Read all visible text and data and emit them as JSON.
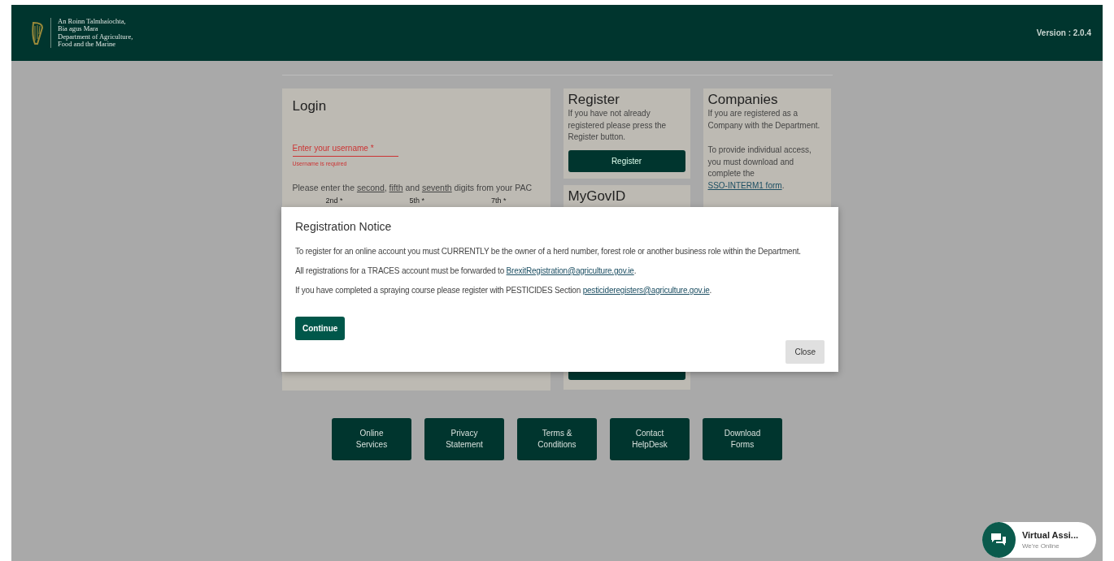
{
  "header": {
    "logo_lines": [
      "An Roinn Talmhaíochta,",
      "Bia agus Mara",
      "Department of Agriculture,",
      "Food and the Marine"
    ],
    "version": "Version : 2.0.4"
  },
  "login": {
    "title": "Login",
    "username": {
      "placeholder": "Enter your username *",
      "error": "Username is required",
      "invalid": true
    },
    "pac_instruction": [
      {
        "text": "Please enter the ",
        "underlined": false
      },
      {
        "text": "second",
        "underlined": true
      },
      {
        "text": ", ",
        "underlined": false
      },
      {
        "text": "fifth",
        "underlined": true
      },
      {
        "text": " and ",
        "underlined": false
      },
      {
        "text": "seventh",
        "underlined": true
      },
      {
        "text": " digits from your PAC",
        "underlined": false
      }
    ],
    "pac_fields": [
      {
        "label": "2nd *"
      },
      {
        "label": "5th *"
      },
      {
        "label": "7th *"
      }
    ]
  },
  "register": {
    "title": "Register",
    "text": "If you have not already registered please press the Register button.",
    "button": "Register"
  },
  "mygovid": {
    "title": "MyGovID"
  },
  "companies": {
    "title": "Companies",
    "text": "If you are registered as a Company with the Department.",
    "access_text": "To provide individual access, you must download and complete the",
    "link": "SSO-INTERM1 form",
    "after_link": "."
  },
  "modal": {
    "title": "Registration Notice",
    "paragraphs": [
      [
        {
          "text": "To register for an online account you must CURRENTLY be the owner of a herd number, forest role or another business role within the Department.",
          "link": false
        }
      ],
      [
        {
          "text": "All registrations for a TRACES account must be forwarded to ",
          "link": false
        },
        {
          "text": "BrexitRegistration@agriculture.gov.ie",
          "link": true
        },
        {
          "text": ".",
          "link": false
        }
      ],
      [
        {
          "text": "If you have completed a spraying course please register with PESTICIDES Section ",
          "link": false
        },
        {
          "text": "pesticideregisters@agriculture.gov.ie",
          "link": true
        },
        {
          "text": ".",
          "link": false
        }
      ]
    ],
    "continue": "Continue",
    "close": "Close"
  },
  "footer_buttons": [
    [
      "Online",
      "Services"
    ],
    [
      "Privacy",
      "Statement"
    ],
    [
      "Terms &",
      "Conditions"
    ],
    [
      "Contact",
      "HelpDesk"
    ],
    [
      "Download",
      "Forms"
    ]
  ],
  "chat": {
    "title": "Virtual Assi...",
    "status": "We're Online"
  }
}
